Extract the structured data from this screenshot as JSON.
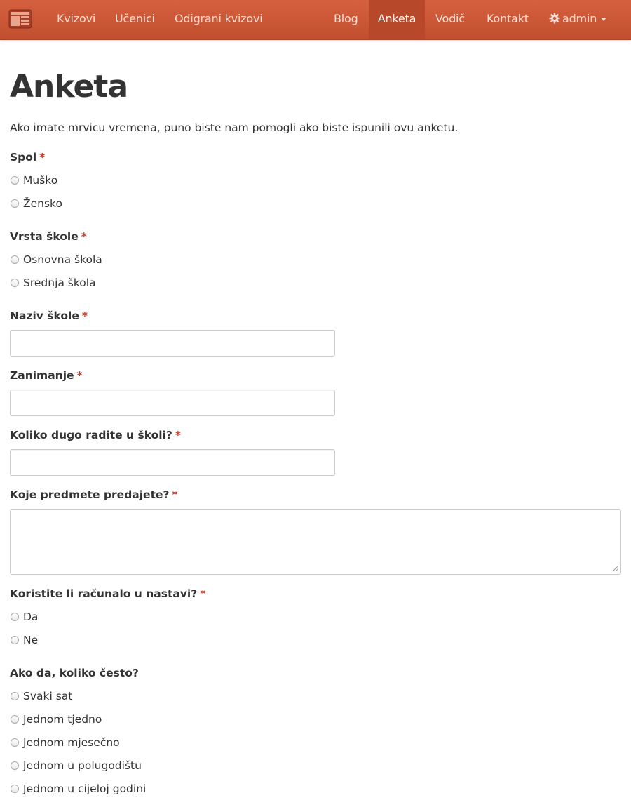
{
  "nav": {
    "brand_icon": "quiz-logo-icon",
    "left_items": [
      "Kvizovi",
      "Učenici",
      "Odigrani kvizovi"
    ],
    "right_items": [
      "Blog",
      "Anketa",
      "Vodič",
      "Kontakt"
    ],
    "active": "Anketa",
    "user_label": "admin",
    "user_icon": "gear-icon",
    "colors": {
      "bar": "#c8553a",
      "active": "#b8482a",
      "text": "#f6ddd3"
    }
  },
  "page": {
    "title": "Anketa",
    "intro": "Ako imate mrvicu vremena, puno biste nam pomogli ako biste ispunili ovu anketu.",
    "required_marker": "*",
    "required_color": "#c0392b"
  },
  "form": {
    "spol": {
      "label": "Spol",
      "options": [
        "Muško",
        "Žensko"
      ]
    },
    "vrsta_skole": {
      "label": "Vrsta škole",
      "options": [
        "Osnovna škola",
        "Srednja škola"
      ]
    },
    "naziv_skole": {
      "label": "Naziv škole",
      "value": ""
    },
    "zanimanje": {
      "label": "Zanimanje",
      "value": ""
    },
    "staz": {
      "label": "Koliko dugo radite u školi?",
      "value": ""
    },
    "predmeti": {
      "label": "Koje predmete predajete?",
      "value": ""
    },
    "racunalo": {
      "label": "Koristite li računalo u nastavi?",
      "options": [
        "Da",
        "Ne"
      ]
    },
    "cestoca": {
      "label": "Ako da, koliko često?",
      "options": [
        "Svaki sat",
        "Jednom tjedno",
        "Jednom mjesečno",
        "Jednom u polugodištu",
        "Jednom u cijeloj godini"
      ]
    }
  }
}
